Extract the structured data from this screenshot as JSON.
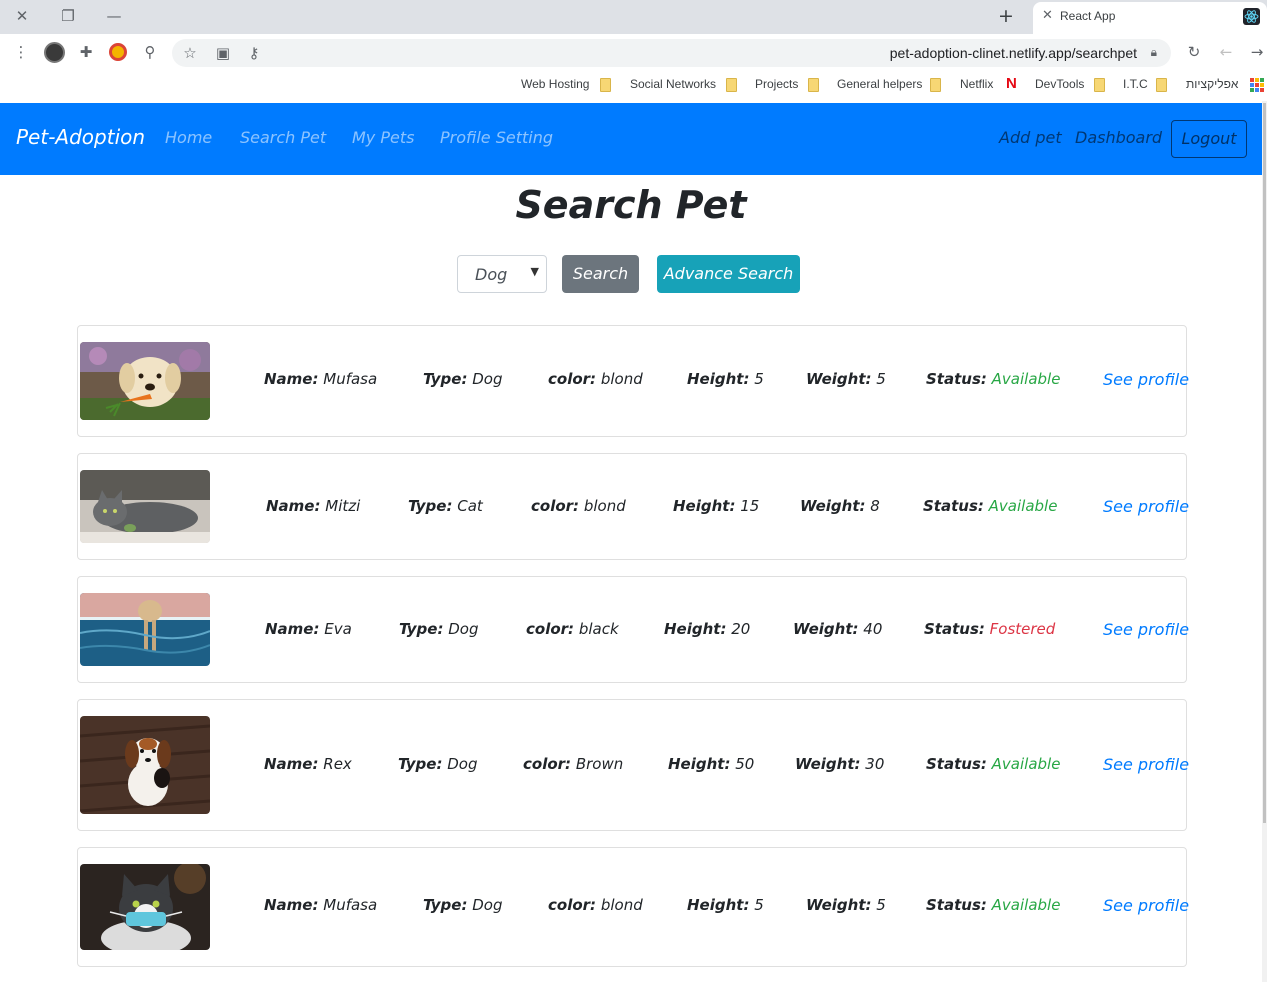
{
  "browser": {
    "tab_title": "React App",
    "new_tab_label": "+",
    "url": "pet-adoption-clinet.netlify.app/searchpet",
    "bookmarks": [
      "Web Hosting",
      "Social Networks",
      "Projects",
      "General helpers",
      "Netflix",
      "DevTools",
      "I.T.C",
      "אפליקציות"
    ],
    "netflix_logo": "N"
  },
  "navbar": {
    "brand": "Pet-Adoption",
    "links": [
      "Home",
      "Search Pet",
      "My Pets",
      "Profile Setting"
    ],
    "right_links": [
      "Add pet",
      "Dashboard"
    ],
    "logout": "Logout",
    "color": "#007bff"
  },
  "search": {
    "title": "Search Pet",
    "type_selected": "Dog",
    "search_button": "Search",
    "advance_button": "Advance Search"
  },
  "labels": {
    "name": "Name:",
    "type": "Type:",
    "color": "color:",
    "height": "Height:",
    "weight": "Weight:",
    "status": "Status:",
    "see_profile": "See profile"
  },
  "pets": [
    {
      "name": "Mufasa",
      "type": "Dog",
      "color": "blond",
      "height": "5",
      "weight": "5",
      "status": "Available",
      "image": "golden-retriever-with-carrot"
    },
    {
      "name": "Mitzi",
      "type": "Cat",
      "color": "blond",
      "height": "15",
      "weight": "8",
      "status": "Available",
      "image": "grey-cat-lying"
    },
    {
      "name": "Eva",
      "type": "Dog",
      "color": "black",
      "height": "20",
      "weight": "40",
      "status": "Fostered",
      "image": "dog-swimming-pool"
    },
    {
      "name": "Rex",
      "type": "Dog",
      "color": "Brown",
      "height": "50",
      "weight": "30",
      "status": "Available",
      "image": "beagle-puppy"
    },
    {
      "name": "Mufasa",
      "type": "Dog",
      "color": "blond",
      "height": "5",
      "weight": "5",
      "status": "Available",
      "image": "cat-with-mask"
    }
  ],
  "colors": {
    "available": "#28a745",
    "fostered": "#dc3545",
    "link": "#007bff",
    "search_button": "#6c757d",
    "advance_button": "#17a2b8"
  }
}
